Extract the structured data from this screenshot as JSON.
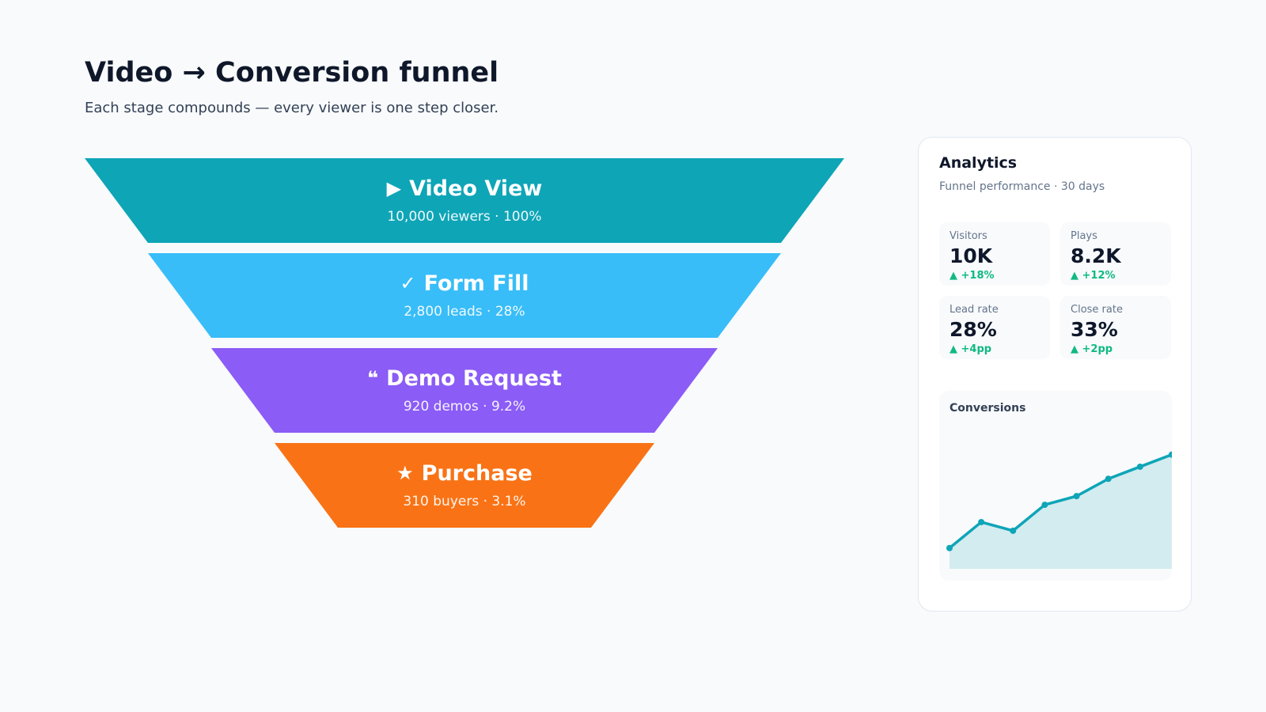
{
  "header": {
    "title": "Video → Conversion funnel",
    "subtitle": "Each stage compounds — every viewer is one step closer."
  },
  "funnel": {
    "stages": [
      {
        "icon": "▶",
        "icon_name": "play-icon",
        "label": "Video View",
        "meta": "10,000 viewers · 100%",
        "value": 10000,
        "percent": 100,
        "color": "#0ea5b7"
      },
      {
        "icon": "✓",
        "icon_name": "check-icon",
        "label": "Form Fill",
        "meta": "2,800 leads · 28%",
        "value": 2800,
        "percent": 28,
        "color": "#38bdf8"
      },
      {
        "icon": "❝",
        "icon_name": "quote-icon",
        "label": "Demo Request",
        "meta": "920 demos · 9.2%",
        "value": 920,
        "percent": 9.2,
        "color": "#8b5cf6"
      },
      {
        "icon": "★",
        "icon_name": "star-icon",
        "label": "Purchase",
        "meta": "310 buyers · 3.1%",
        "value": 310,
        "percent": 3.1,
        "color": "#f97316"
      }
    ]
  },
  "analytics": {
    "title": "Analytics",
    "subtitle": "Funnel performance · 30 days",
    "kpis": [
      {
        "label": "Visitors",
        "value": "10K",
        "delta": "▲ +18%"
      },
      {
        "label": "Plays",
        "value": "8.2K",
        "delta": "▲ +12%"
      },
      {
        "label": "Lead rate",
        "value": "28%",
        "delta": "▲ +4pp"
      },
      {
        "label": "Close rate",
        "value": "33%",
        "delta": "▲ +2pp"
      }
    ],
    "delta_color": "#10b981",
    "chart_title": "Conversions"
  },
  "chart_data": [
    {
      "type": "bar",
      "title": "",
      "categories": [
        "Video View",
        "Form Fill",
        "Demo Request",
        "Purchase"
      ],
      "values": [
        10000,
        2800,
        920,
        310
      ],
      "percent": [
        100,
        28,
        9.2,
        3.1
      ]
    },
    {
      "type": "area",
      "title": "Conversions",
      "x": [
        1,
        2,
        3,
        4,
        5,
        6,
        7,
        8
      ],
      "values": [
        12,
        27,
        22,
        37,
        42,
        52,
        59,
        66
      ],
      "ylim": [
        0,
        80
      ],
      "grid": false,
      "line_color": "#0ea5b7",
      "fill_color": "#d3ecf0"
    }
  ]
}
